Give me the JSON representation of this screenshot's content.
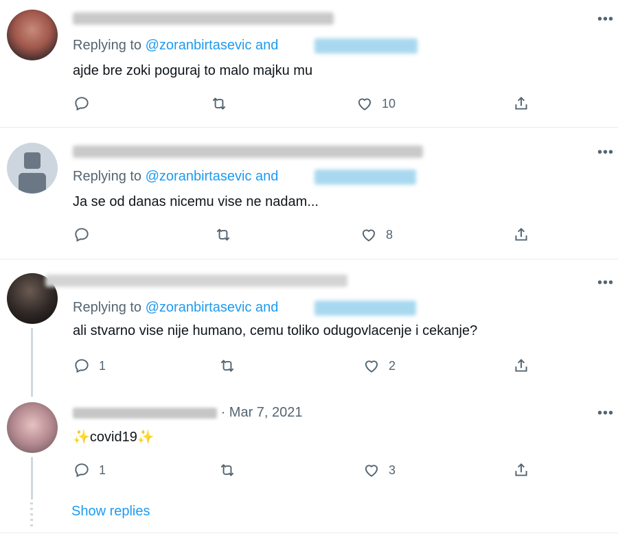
{
  "tweets": [
    {
      "replying_label": "Replying to",
      "mention": "@zoranbirtasevic",
      "and_label": "and",
      "text": "ajde bre zoki poguraj to malo majku mu",
      "reply_count": "",
      "retweet_count": "",
      "like_count": "10"
    },
    {
      "replying_label": "Replying to",
      "mention": "@zoranbirtasevic",
      "and_label": "and",
      "text": "Ja se od danas nicemu vise ne nadam...",
      "reply_count": "",
      "retweet_count": "",
      "like_count": "8"
    },
    {
      "replying_label": "Replying to",
      "mention": "@zoranbirtasevic",
      "and_label": "and",
      "text": "ali stvarno vise nije humano, cemu toliko odugovlacenje i cekanje?",
      "reply_count": "1",
      "retweet_count": "",
      "like_count": "2"
    },
    {
      "dot": "·",
      "date": "Mar 7, 2021",
      "text_emoji": "✨",
      "text_main": "covid19",
      "reply_count": "1",
      "retweet_count": "",
      "like_count": "3"
    }
  ],
  "show_replies": "Show replies",
  "icons": {
    "more": "more-icon",
    "reply": "reply-icon",
    "retweet": "retweet-icon",
    "like": "heart-icon",
    "share": "share-icon"
  },
  "colors": {
    "accent": "#1d9bf0",
    "muted": "#536471",
    "divider": "#e6ecf0"
  }
}
